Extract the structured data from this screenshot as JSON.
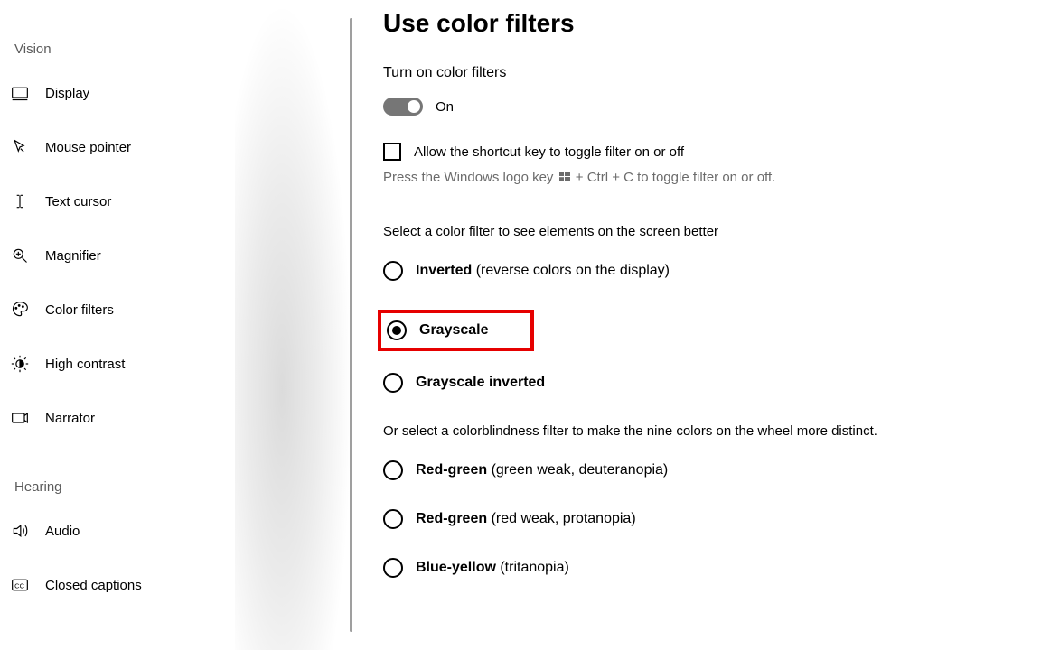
{
  "sidebar": {
    "sections": {
      "vision": "Vision",
      "hearing": "Hearing"
    },
    "items": {
      "display": "Display",
      "mouse_pointer": "Mouse pointer",
      "text_cursor": "Text cursor",
      "magnifier": "Magnifier",
      "color_filters": "Color filters",
      "high_contrast": "High contrast",
      "narrator": "Narrator",
      "audio": "Audio",
      "closed_captions": "Closed captions"
    }
  },
  "main": {
    "title": "Use color filters",
    "turn_on_label": "Turn on color filters",
    "toggle_state": "On",
    "allow_shortcut_label": "Allow the shortcut key to toggle filter on or off",
    "hint_prefix": "Press the Windows logo key ",
    "hint_suffix": " + Ctrl + C to toggle filter on or off.",
    "select_filter_text": "Select a color filter to see elements on the screen better",
    "colorblind_text": "Or select a colorblindness filter to make the nine colors on the wheel more distinct.",
    "radios": {
      "inverted_bold": "Inverted",
      "inverted_rest": " (reverse colors on the display)",
      "grayscale_bold": "Grayscale",
      "grayscale_inverted_bold": "Grayscale inverted",
      "red_green_deut_bold": "Red-green",
      "red_green_deut_rest": " (green weak, deuteranopia)",
      "red_green_prot_bold": "Red-green",
      "red_green_prot_rest": " (red weak, protanopia)",
      "blue_yellow_bold": "Blue-yellow",
      "blue_yellow_rest": " (tritanopia)"
    }
  }
}
